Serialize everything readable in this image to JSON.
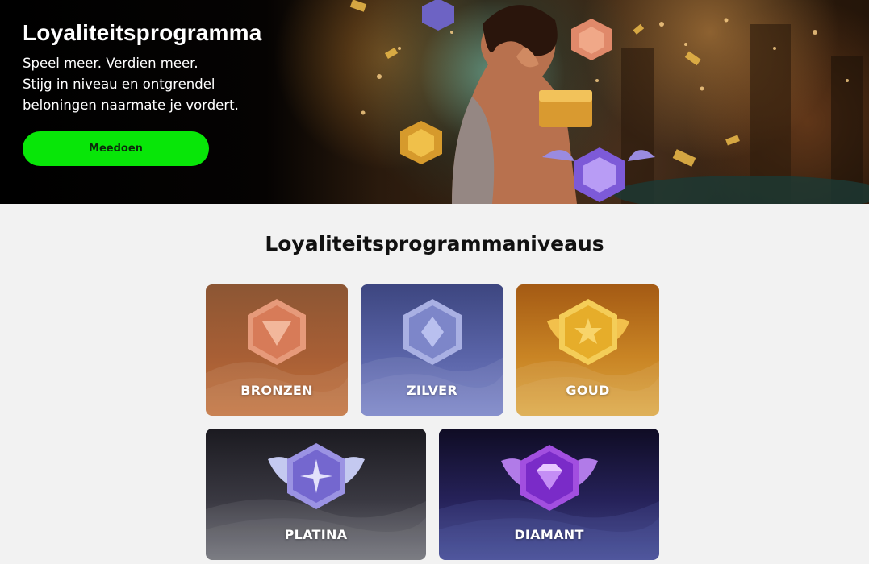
{
  "hero": {
    "title": "Loyaliteitsprogramma",
    "subtitle_lines": [
      "Speel meer. Verdien meer.",
      "Stijg in niveau en ontgrendel",
      "beloningen naarmate je vordert."
    ],
    "join_label": "Meedoen",
    "join_color": "#08e608"
  },
  "levels": {
    "title": "Loyaliteitsprogrammaniveaus",
    "items": [
      {
        "label": "BRONZEN",
        "icon": "bronze-badge-icon"
      },
      {
        "label": "ZILVER",
        "icon": "silver-badge-icon"
      },
      {
        "label": "GOUD",
        "icon": "gold-badge-icon"
      },
      {
        "label": "PLATINA",
        "icon": "platinum-badge-icon"
      },
      {
        "label": "DIAMANT",
        "icon": "diamond-badge-icon"
      }
    ]
  }
}
